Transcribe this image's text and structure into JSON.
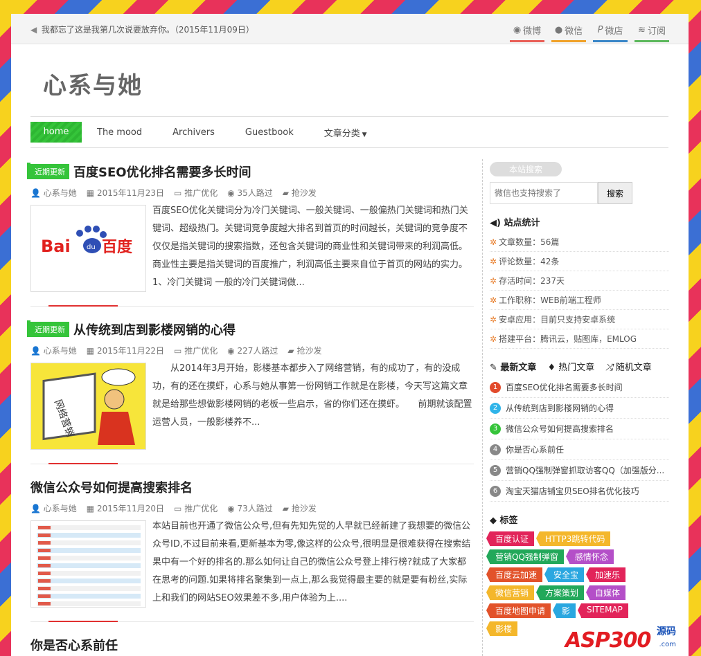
{
  "notice": "我都忘了这是我第几次说要放弃你。（2015年11月09日）",
  "social": [
    {
      "label": "微博",
      "icon": "weibo-icon",
      "color": "#e95f57"
    },
    {
      "label": "微信",
      "icon": "wechat-icon",
      "color": "#f0a22a"
    },
    {
      "label": "微店",
      "icon": "p-icon",
      "color": "#3a86c8"
    },
    {
      "label": "订阅",
      "icon": "rss-icon",
      "color": "#5cb85c"
    }
  ],
  "site": {
    "title": "心系与她"
  },
  "nav": {
    "items": [
      "home",
      "The mood",
      "Archivers",
      "Guestbook"
    ],
    "dropdown": "文章分类"
  },
  "posts": [
    {
      "badge": "近期更新",
      "title": "百度SEO优化排名需要多长时间",
      "author": "心系与她",
      "date": "2015年11月23日",
      "category": "推广优化",
      "views": "35人路过",
      "comment": "抢沙发",
      "thumb": "百度",
      "excerpt": "百度SEO优化关键词分为冷门关键词、一般关键词、一般偏热门关键词和热门关键词、超级热门。关键词竞争度越大排名到首页的时间越长，关键词的竞争度不仅仅是指关键词的搜索指数，还包含关键词的商业性和关键词带来的利润高低。商业性主要是指关键词的百度推广，利润高低主要来自位于首页的网站的实力。 1、冷门关键词 一般的冷门关键词做..."
    },
    {
      "badge": "近期更新",
      "title": "从传统到店到影楼网销的心得",
      "author": "心系与她",
      "date": "2015年11月22日",
      "category": "推广优化",
      "views": "227人路过",
      "comment": "抢沙发",
      "thumb": "网络营销",
      "excerpt": "从2014年3月开始，影楼基本都步入了网络营销，有的成功了，有的没成功，有的还在摸虾，心系与她从事第一份网销工作就是在影楼，今天写这篇文章就是给那些想做影楼网销的老板一些启示，省的你们还在摸虾。　　前期就该配置运营人员，一般影楼养不..."
    },
    {
      "badge": "",
      "title": "微信公众号如何提高搜索排名",
      "author": "心系与她",
      "date": "2015年11月20日",
      "category": "推广优化",
      "views": "73人路过",
      "comment": "抢沙发",
      "thumb": "",
      "excerpt": "本站目前也开通了微信公众号,但有先知先觉的人早就已经新建了我想要的微信公众号ID,不过目前来看,更新基本为零,像这样的公众号,很明显是很难获得在搜索结果中有一个好的排名的.那么如何让自己的微信公众号登上排行榜?就成了大家都在思考的问题.如果将排名聚集到一点上,那么我觉得最主要的就是要有粉丝,实际上和我们的网站SEO效果差不多,用户体验为上...."
    },
    {
      "badge": "",
      "title": "你是否心系前任"
    }
  ],
  "sidebar": {
    "search_label": "本站搜索",
    "search_placeholder": "微信也支持搜索了",
    "search_button": "搜索",
    "stats_title": "站点统计",
    "stats": [
      "文章数量：56篇",
      "评论数量：42条",
      "存活时间：237天",
      "工作职称：WEB前端工程师",
      "安卓应用：目前只支持安卓系统",
      "搭建平台：腾讯云，贴图库，EMLOG"
    ],
    "tabs": [
      "最新文章",
      "热门文章",
      "随机文章"
    ],
    "articles": [
      {
        "n": "1",
        "t": "百度SEO优化排名需要多长时间",
        "c": "#e24b2c"
      },
      {
        "n": "2",
        "t": "从传统到店到影楼网销的心得",
        "c": "#2fb4e9"
      },
      {
        "n": "3",
        "t": "微信公众号如何提高搜索排名",
        "c": "#35c43a"
      },
      {
        "n": "4",
        "t": "你是否心系前任",
        "c": "#888888"
      },
      {
        "n": "5",
        "t": "营销QQ强制弹窗抓取访客QQ（加强版分...",
        "c": "#888888"
      },
      {
        "n": "6",
        "t": "淘宝天猫店铺宝贝SEO排名优化技巧",
        "c": "#888888"
      }
    ],
    "tags_title": "标签",
    "tags": [
      {
        "t": "百度认证",
        "c": "#e2245a"
      },
      {
        "t": "HTTP3跳转代码",
        "c": "#f4b72b"
      },
      {
        "t": "营销QQ强制弹窗",
        "c": "#22a85a"
      },
      {
        "t": "感情怀念",
        "c": "#b44fc8"
      },
      {
        "t": "百度云加速",
        "c": "#e2522a"
      },
      {
        "t": "安全宝",
        "c": "#2aa7e0"
      },
      {
        "t": "加速乐",
        "c": "#e2245a"
      },
      {
        "t": "微信营销",
        "c": "#f4b72b"
      },
      {
        "t": "方案策划",
        "c": "#22a85a"
      },
      {
        "t": "自媒体",
        "c": "#b44fc8"
      },
      {
        "t": "百度地图申请",
        "c": "#e2522a"
      },
      {
        "t": "影",
        "c": "#2aa7e0"
      },
      {
        "t": "SITEMAP",
        "c": "#e2245a"
      },
      {
        "t": "影楼",
        "c": "#f4b72b"
      }
    ]
  },
  "watermark": {
    "brand": "ASP300",
    "suffix": "源码",
    "domain": ".com"
  }
}
